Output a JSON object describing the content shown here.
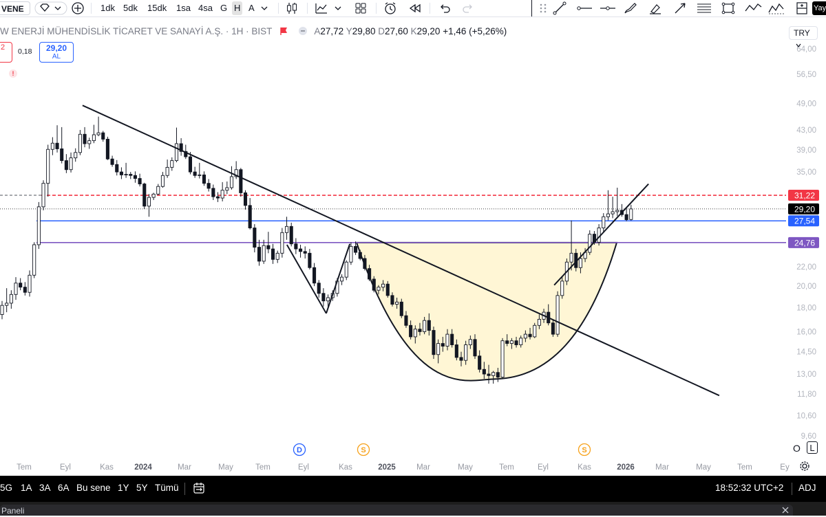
{
  "toolbar": {
    "symbol": "VENE",
    "intervals": [
      "1dk",
      "5dk",
      "15dk",
      "1sa",
      "4sa",
      "G",
      "H",
      "A"
    ],
    "active_interval": "H",
    "right_edge_label": "Yay"
  },
  "legend": {
    "name": "W ENERJİ MÜHENDİSLİK TİCARET VE SANAYİ A.Ş. · 1H · BIST",
    "o_label": "A",
    "o": "27,72",
    "h_label": "Y",
    "h": "29,80",
    "l_label": "D",
    "l": "27,60",
    "c_label": "K",
    "c": "29,20",
    "change": "+1,46 (+5,26%)",
    "sell_price": "2",
    "spread": "0,18",
    "buy_price": "29,20",
    "buy_label": "AL",
    "flag_icon": "!"
  },
  "currency": "TRY",
  "bottom": {
    "ranges": [
      "5G",
      "1A",
      "3A",
      "6A",
      "Bu sene",
      "1Y",
      "5Y",
      "Tümü"
    ],
    "time": "18:52:32 UTC+2",
    "adj": "ADJ",
    "log_label": "O",
    "log_toggle": "L",
    "panel_label": "Paneli"
  },
  "chart_data": {
    "type": "candlestick",
    "timeframe": "1W",
    "y_scale": "log",
    "y_ticks": [
      "64,00",
      "56,50",
      "49,00",
      "43,00",
      "39,00",
      "35,00",
      "22,00",
      "20,00",
      "18,00",
      "16,00",
      "14,50",
      "13,00",
      "11,80",
      "10,60",
      "9,60"
    ],
    "x_ticks": [
      "Tem",
      "Eyl",
      "Kas",
      "2024",
      "Mar",
      "May",
      "Tem",
      "Eyl",
      "Kas",
      "2025",
      "Mar",
      "May",
      "Tem",
      "Eyl",
      "Kas",
      "2026",
      "Mar",
      "May",
      "Tem",
      "Ey"
    ],
    "bold_x_ticks": [
      "2024",
      "2025",
      "2026"
    ],
    "price_levels": [
      {
        "label": "31,22",
        "value": 31.22,
        "color": "#f23645",
        "style": "dashed"
      },
      {
        "label": "29,20",
        "value": 29.2,
        "color": "#000000",
        "style": "dotted"
      },
      {
        "label": "27,54",
        "value": 27.54,
        "color": "#2962ff",
        "style": "solid"
      },
      {
        "label": "24,76",
        "value": 24.76,
        "color": "#7e57c2",
        "style": "solid"
      }
    ],
    "events": [
      {
        "label": "D",
        "color": "#2962ff",
        "x_tick": "Eyl"
      },
      {
        "label": "S",
        "color": "#f7a21b",
        "x_tick": "Kas"
      },
      {
        "label": "S",
        "color": "#f7a21b",
        "x_tick": "Kas"
      }
    ],
    "candles": [
      {
        "o": 17.4,
        "h": 18.6,
        "l": 17.0,
        "c": 18.2
      },
      {
        "o": 18.2,
        "h": 19.8,
        "l": 17.6,
        "c": 18.4
      },
      {
        "o": 18.4,
        "h": 19.6,
        "l": 17.9,
        "c": 19.2
      },
      {
        "o": 19.2,
        "h": 20.9,
        "l": 18.7,
        "c": 20.3
      },
      {
        "o": 20.3,
        "h": 20.8,
        "l": 19.6,
        "c": 19.9
      },
      {
        "o": 19.9,
        "h": 20.4,
        "l": 19.1,
        "c": 19.4
      },
      {
        "o": 19.4,
        "h": 21.6,
        "l": 19.0,
        "c": 21.1
      },
      {
        "o": 21.1,
        "h": 24.8,
        "l": 20.8,
        "c": 24.5
      },
      {
        "o": 24.5,
        "h": 30.2,
        "l": 24.0,
        "c": 29.5
      },
      {
        "o": 29.5,
        "h": 33.6,
        "l": 29.0,
        "c": 33.1
      },
      {
        "o": 33.1,
        "h": 40.0,
        "l": 31.0,
        "c": 39.1
      },
      {
        "o": 39.1,
        "h": 41.5,
        "l": 38.0,
        "c": 40.3
      },
      {
        "o": 40.3,
        "h": 44.0,
        "l": 38.5,
        "c": 39.2
      },
      {
        "o": 39.2,
        "h": 43.6,
        "l": 36.5,
        "c": 37.0
      },
      {
        "o": 37.0,
        "h": 38.2,
        "l": 34.8,
        "c": 35.4
      },
      {
        "o": 35.4,
        "h": 38.5,
        "l": 34.9,
        "c": 37.5
      },
      {
        "o": 37.5,
        "h": 39.3,
        "l": 36.8,
        "c": 38.5
      },
      {
        "o": 38.5,
        "h": 43.0,
        "l": 38.0,
        "c": 42.1
      },
      {
        "o": 42.1,
        "h": 43.6,
        "l": 39.5,
        "c": 40.2
      },
      {
        "o": 40.2,
        "h": 41.4,
        "l": 39.2,
        "c": 40.8
      },
      {
        "o": 40.8,
        "h": 44.1,
        "l": 40.3,
        "c": 42.0
      },
      {
        "o": 42.0,
        "h": 45.9,
        "l": 41.7,
        "c": 42.4
      },
      {
        "o": 42.4,
        "h": 42.8,
        "l": 40.6,
        "c": 41.1
      },
      {
        "o": 41.1,
        "h": 41.6,
        "l": 37.1,
        "c": 37.3
      },
      {
        "o": 37.3,
        "h": 37.9,
        "l": 35.9,
        "c": 36.3
      },
      {
        "o": 36.3,
        "h": 37.1,
        "l": 34.4,
        "c": 35.0
      },
      {
        "o": 35.0,
        "h": 35.8,
        "l": 33.8,
        "c": 34.5
      },
      {
        "o": 34.5,
        "h": 36.6,
        "l": 34.0,
        "c": 34.6
      },
      {
        "o": 34.6,
        "h": 35.0,
        "l": 33.8,
        "c": 34.4
      },
      {
        "o": 34.4,
        "h": 35.1,
        "l": 33.2,
        "c": 33.9
      },
      {
        "o": 33.9,
        "h": 34.7,
        "l": 32.6,
        "c": 33.0
      },
      {
        "o": 33.0,
        "h": 33.2,
        "l": 29.2,
        "c": 29.6
      },
      {
        "o": 29.6,
        "h": 31.4,
        "l": 28.1,
        "c": 30.9
      },
      {
        "o": 30.9,
        "h": 31.6,
        "l": 30.5,
        "c": 31.4
      },
      {
        "o": 31.4,
        "h": 33.0,
        "l": 31.2,
        "c": 32.6
      },
      {
        "o": 32.6,
        "h": 35.0,
        "l": 32.4,
        "c": 34.4
      },
      {
        "o": 34.4,
        "h": 37.2,
        "l": 34.0,
        "c": 35.8
      },
      {
        "o": 35.8,
        "h": 37.6,
        "l": 35.2,
        "c": 37.0
      },
      {
        "o": 37.0,
        "h": 43.5,
        "l": 36.7,
        "c": 40.2
      },
      {
        "o": 40.2,
        "h": 41.3,
        "l": 37.9,
        "c": 38.7
      },
      {
        "o": 38.7,
        "h": 40.0,
        "l": 37.3,
        "c": 37.7
      },
      {
        "o": 37.7,
        "h": 38.6,
        "l": 34.6,
        "c": 35.0
      },
      {
        "o": 35.0,
        "h": 35.9,
        "l": 34.0,
        "c": 34.4
      },
      {
        "o": 34.4,
        "h": 36.6,
        "l": 33.9,
        "c": 34.5
      },
      {
        "o": 34.5,
        "h": 35.1,
        "l": 32.7,
        "c": 33.1
      },
      {
        "o": 33.1,
        "h": 33.8,
        "l": 31.8,
        "c": 32.3
      },
      {
        "o": 32.3,
        "h": 32.9,
        "l": 30.5,
        "c": 31.0
      },
      {
        "o": 31.0,
        "h": 31.7,
        "l": 30.2,
        "c": 30.8
      },
      {
        "o": 30.8,
        "h": 33.3,
        "l": 30.3,
        "c": 32.0
      },
      {
        "o": 32.0,
        "h": 33.4,
        "l": 31.4,
        "c": 32.4
      },
      {
        "o": 32.4,
        "h": 36.0,
        "l": 32.1,
        "c": 34.2
      },
      {
        "o": 34.2,
        "h": 36.9,
        "l": 33.8,
        "c": 35.4
      },
      {
        "o": 35.4,
        "h": 35.7,
        "l": 31.0,
        "c": 31.6
      },
      {
        "o": 31.6,
        "h": 32.0,
        "l": 29.1,
        "c": 29.7
      },
      {
        "o": 29.7,
        "h": 30.8,
        "l": 26.4,
        "c": 26.6
      },
      {
        "o": 26.6,
        "h": 27.1,
        "l": 23.6,
        "c": 24.2
      },
      {
        "o": 24.2,
        "h": 25.1,
        "l": 22.1,
        "c": 22.6
      },
      {
        "o": 22.6,
        "h": 25.1,
        "l": 22.3,
        "c": 24.4
      },
      {
        "o": 24.4,
        "h": 26.1,
        "l": 23.5,
        "c": 24.0
      },
      {
        "o": 24.0,
        "h": 24.6,
        "l": 22.3,
        "c": 22.8
      },
      {
        "o": 22.8,
        "h": 23.8,
        "l": 22.4,
        "c": 23.5
      },
      {
        "o": 23.5,
        "h": 26.6,
        "l": 23.0,
        "c": 26.0
      },
      {
        "o": 26.0,
        "h": 28.1,
        "l": 25.1,
        "c": 26.8
      },
      {
        "o": 26.8,
        "h": 27.3,
        "l": 24.3,
        "c": 24.6
      },
      {
        "o": 24.6,
        "h": 25.3,
        "l": 23.4,
        "c": 24.0
      },
      {
        "o": 24.0,
        "h": 24.5,
        "l": 23.0,
        "c": 23.7
      },
      {
        "o": 23.7,
        "h": 24.3,
        "l": 22.9,
        "c": 23.5
      },
      {
        "o": 23.5,
        "h": 24.0,
        "l": 21.7,
        "c": 21.9
      },
      {
        "o": 21.9,
        "h": 22.4,
        "l": 20.0,
        "c": 20.3
      },
      {
        "o": 20.3,
        "h": 20.6,
        "l": 18.9,
        "c": 19.3
      },
      {
        "o": 19.3,
        "h": 19.8,
        "l": 18.1,
        "c": 18.6
      },
      {
        "o": 18.6,
        "h": 19.2,
        "l": 17.9,
        "c": 18.9
      },
      {
        "o": 18.9,
        "h": 19.6,
        "l": 18.6,
        "c": 19.3
      },
      {
        "o": 19.3,
        "h": 20.8,
        "l": 19.0,
        "c": 20.5
      },
      {
        "o": 20.5,
        "h": 21.2,
        "l": 20.1,
        "c": 20.9
      },
      {
        "o": 20.9,
        "h": 22.7,
        "l": 20.6,
        "c": 22.5
      },
      {
        "o": 22.5,
        "h": 24.8,
        "l": 22.2,
        "c": 24.3
      },
      {
        "o": 24.3,
        "h": 24.9,
        "l": 23.3,
        "c": 23.6
      },
      {
        "o": 23.6,
        "h": 23.9,
        "l": 22.7,
        "c": 22.9
      },
      {
        "o": 22.9,
        "h": 23.3,
        "l": 21.6,
        "c": 21.8
      },
      {
        "o": 21.8,
        "h": 22.2,
        "l": 20.5,
        "c": 20.7
      },
      {
        "o": 20.7,
        "h": 21.0,
        "l": 19.4,
        "c": 19.6
      },
      {
        "o": 19.6,
        "h": 20.1,
        "l": 19.2,
        "c": 19.9
      },
      {
        "o": 19.9,
        "h": 20.6,
        "l": 19.5,
        "c": 20.2
      },
      {
        "o": 20.2,
        "h": 20.5,
        "l": 18.9,
        "c": 19.1
      },
      {
        "o": 19.1,
        "h": 19.4,
        "l": 18.1,
        "c": 18.3
      },
      {
        "o": 18.3,
        "h": 18.9,
        "l": 17.9,
        "c": 18.5
      },
      {
        "o": 18.5,
        "h": 18.8,
        "l": 17.1,
        "c": 17.3
      },
      {
        "o": 17.3,
        "h": 17.7,
        "l": 16.3,
        "c": 16.5
      },
      {
        "o": 16.5,
        "h": 16.9,
        "l": 15.4,
        "c": 15.6
      },
      {
        "o": 15.6,
        "h": 16.5,
        "l": 15.1,
        "c": 16.2
      },
      {
        "o": 16.2,
        "h": 16.7,
        "l": 15.7,
        "c": 16.0
      },
      {
        "o": 16.0,
        "h": 17.2,
        "l": 15.8,
        "c": 16.9
      },
      {
        "o": 16.9,
        "h": 17.5,
        "l": 15.7,
        "c": 16.1
      },
      {
        "o": 16.1,
        "h": 16.4,
        "l": 14.0,
        "c": 14.3
      },
      {
        "o": 14.3,
        "h": 15.4,
        "l": 13.7,
        "c": 15.1
      },
      {
        "o": 15.1,
        "h": 15.6,
        "l": 14.5,
        "c": 14.9
      },
      {
        "o": 14.9,
        "h": 16.2,
        "l": 14.6,
        "c": 15.8
      },
      {
        "o": 15.8,
        "h": 16.2,
        "l": 14.8,
        "c": 15.0
      },
      {
        "o": 15.0,
        "h": 15.4,
        "l": 13.9,
        "c": 14.1
      },
      {
        "o": 14.1,
        "h": 14.5,
        "l": 13.5,
        "c": 13.9
      },
      {
        "o": 13.9,
        "h": 15.3,
        "l": 13.6,
        "c": 15.0
      },
      {
        "o": 15.0,
        "h": 15.7,
        "l": 14.7,
        "c": 15.4
      },
      {
        "o": 15.4,
        "h": 15.8,
        "l": 14.0,
        "c": 14.2
      },
      {
        "o": 14.2,
        "h": 14.6,
        "l": 13.1,
        "c": 13.3
      },
      {
        "o": 13.3,
        "h": 13.8,
        "l": 12.7,
        "c": 13.0
      },
      {
        "o": 13.0,
        "h": 13.6,
        "l": 12.4,
        "c": 12.9
      },
      {
        "o": 12.9,
        "h": 13.2,
        "l": 12.4,
        "c": 13.1
      },
      {
        "o": 13.1,
        "h": 13.4,
        "l": 12.5,
        "c": 12.8
      },
      {
        "o": 12.8,
        "h": 15.5,
        "l": 12.7,
        "c": 15.3
      },
      {
        "o": 15.3,
        "h": 15.8,
        "l": 14.9,
        "c": 15.1
      },
      {
        "o": 15.1,
        "h": 15.5,
        "l": 14.7,
        "c": 15.3
      },
      {
        "o": 15.3,
        "h": 15.6,
        "l": 14.8,
        "c": 15.0
      },
      {
        "o": 15.0,
        "h": 15.7,
        "l": 14.8,
        "c": 15.5
      },
      {
        "o": 15.5,
        "h": 16.1,
        "l": 15.2,
        "c": 15.8
      },
      {
        "o": 15.8,
        "h": 16.3,
        "l": 15.4,
        "c": 15.6
      },
      {
        "o": 15.6,
        "h": 16.7,
        "l": 15.5,
        "c": 16.5
      },
      {
        "o": 16.5,
        "h": 17.4,
        "l": 16.2,
        "c": 17.0
      },
      {
        "o": 17.0,
        "h": 17.9,
        "l": 16.7,
        "c": 17.6
      },
      {
        "o": 17.6,
        "h": 18.3,
        "l": 16.5,
        "c": 16.7
      },
      {
        "o": 16.7,
        "h": 17.0,
        "l": 15.6,
        "c": 15.8
      },
      {
        "o": 15.8,
        "h": 19.5,
        "l": 15.6,
        "c": 19.1
      },
      {
        "o": 19.1,
        "h": 21.0,
        "l": 18.8,
        "c": 20.5
      },
      {
        "o": 20.5,
        "h": 22.9,
        "l": 20.1,
        "c": 22.5
      },
      {
        "o": 22.5,
        "h": 27.6,
        "l": 21.6,
        "c": 23.5
      },
      {
        "o": 23.5,
        "h": 24.0,
        "l": 21.5,
        "c": 21.9
      },
      {
        "o": 21.9,
        "h": 23.6,
        "l": 21.3,
        "c": 22.9
      },
      {
        "o": 22.9,
        "h": 24.1,
        "l": 22.5,
        "c": 23.6
      },
      {
        "o": 23.6,
        "h": 26.3,
        "l": 23.3,
        "c": 25.8
      },
      {
        "o": 25.8,
        "h": 26.2,
        "l": 24.5,
        "c": 24.8
      },
      {
        "o": 24.8,
        "h": 27.1,
        "l": 24.4,
        "c": 26.6
      },
      {
        "o": 26.6,
        "h": 28.6,
        "l": 26.0,
        "c": 28.1
      },
      {
        "o": 28.1,
        "h": 32.0,
        "l": 27.6,
        "c": 28.5
      },
      {
        "o": 28.5,
        "h": 31.0,
        "l": 27.9,
        "c": 28.8
      },
      {
        "o": 28.8,
        "h": 32.4,
        "l": 28.2,
        "c": 29.0
      },
      {
        "o": 29.0,
        "h": 29.9,
        "l": 28.1,
        "c": 28.4
      },
      {
        "o": 28.4,
        "h": 29.5,
        "l": 27.5,
        "c": 27.7
      },
      {
        "o": 27.72,
        "h": 29.8,
        "l": 27.6,
        "c": 29.2
      }
    ],
    "drawings": [
      {
        "type": "trend_line",
        "name": "descending resistance",
        "from": {
          "t": 0.105,
          "p": 48.5
        },
        "to": {
          "t": 0.915,
          "p": 11.7
        }
      },
      {
        "type": "rounded_bottom",
        "name": "cup",
        "rim_price": 24.76,
        "bottom_price": 12.9
      },
      {
        "type": "trend_line",
        "name": "rising support",
        "from": {
          "t": 0.705,
          "p": 20.1
        },
        "to": {
          "t": 0.825,
          "p": 33.0
        }
      },
      {
        "type": "trend_line",
        "name": "v bottom left",
        "from": {
          "t": 0.365,
          "p": 24.5
        },
        "to": {
          "t": 0.415,
          "p": 17.5
        }
      },
      {
        "type": "trend_line",
        "name": "v bottom right",
        "from": {
          "t": 0.415,
          "p": 17.5
        },
        "to": {
          "t": 0.445,
          "p": 24.6
        }
      }
    ]
  }
}
